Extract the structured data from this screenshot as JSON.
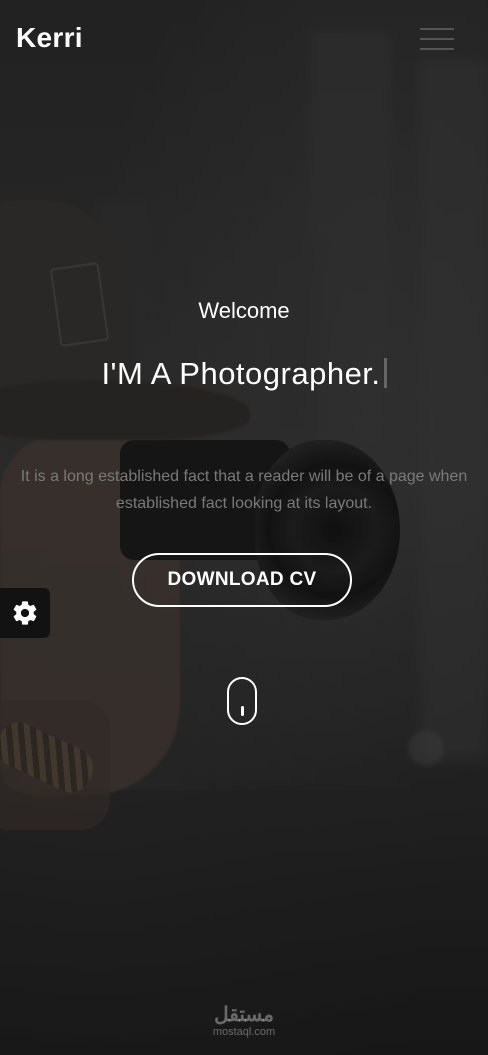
{
  "header": {
    "logo": "Kerri",
    "menu_icon": "hamburger-icon"
  },
  "hero": {
    "welcome": "Welcome",
    "headline": "I'M A Photographer.",
    "description": "It is a long established fact that a reader will be of a page when established fact looking at its layout.",
    "cv_button_label": "DOWNLOAD CV",
    "scroll_icon": "mouse-scroll-icon"
  },
  "settings": {
    "icon": "gear-icon"
  },
  "watermark": {
    "main": "مستقل",
    "sub": "mostaql.com"
  },
  "colors": {
    "overlay": "#141414",
    "text": "#ffffff",
    "muted_text": "#7a7a7a",
    "settings_bg": "#121212"
  }
}
